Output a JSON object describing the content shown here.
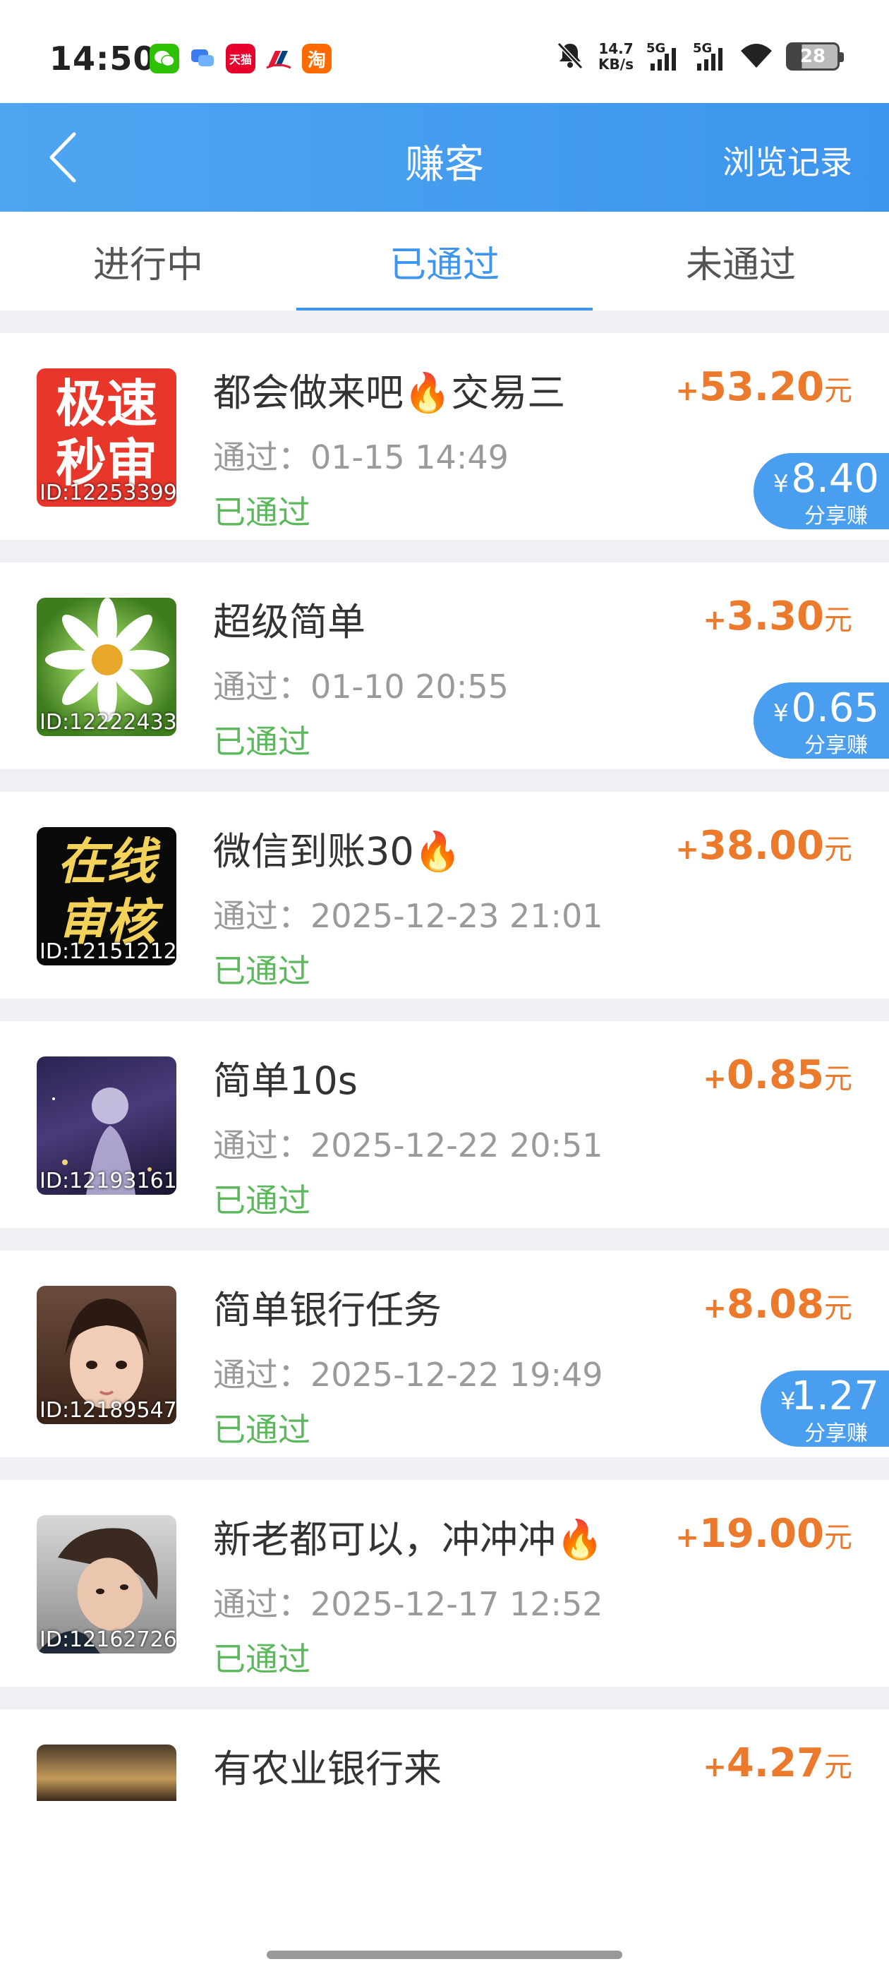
{
  "status_bar": {
    "time": "14:50",
    "net_speed_value": "14.7",
    "net_speed_unit": "KB/s",
    "signal1": "5G",
    "signal2": "5G",
    "battery": "28",
    "notif_icons": [
      "wechat-icon",
      "message-icon",
      "tmall-icon",
      "unionpay-icon",
      "taobao-icon"
    ],
    "tmall_text": "天猫",
    "taobao_text": "淘"
  },
  "header": {
    "title": "赚客",
    "history_label": "浏览记录"
  },
  "tabs": [
    {
      "label": "进行中",
      "active": false
    },
    {
      "label": "已通过",
      "active": true
    },
    {
      "label": "未通过",
      "active": false
    }
  ],
  "tasks": [
    {
      "title": "都会做来吧🔥交易三",
      "time": "通过：01-15 14:49",
      "status": "已通过",
      "plus": "+",
      "amount": "53.20",
      "unit": "元",
      "id": "ID:12253399",
      "thumb_text": [
        "极速",
        "秒审"
      ],
      "share": {
        "yen": "¥",
        "value": "8.40",
        "label": "分享赚"
      }
    },
    {
      "title": "超级简单",
      "time": "通过：01-10 20:55",
      "status": "已通过",
      "plus": "+",
      "amount": "3.30",
      "unit": "元",
      "id": "ID:12222433",
      "share": {
        "yen": "¥",
        "value": "0.65",
        "label": "分享赚"
      }
    },
    {
      "title": "微信到账30🔥",
      "time": "通过：2025-12-23 21:01",
      "status": "已通过",
      "plus": "+",
      "amount": "38.00",
      "unit": "元",
      "id": "ID:12151212",
      "thumb_text": [
        "在线",
        "审核"
      ]
    },
    {
      "title": "简单10s",
      "time": "通过：2025-12-22 20:51",
      "status": "已通过",
      "plus": "+",
      "amount": "0.85",
      "unit": "元",
      "id": "ID:12193161"
    },
    {
      "title": "简单银行任务",
      "time": "通过：2025-12-22 19:49",
      "status": "已通过",
      "plus": "+",
      "amount": "8.08",
      "unit": "元",
      "id": "ID:12189547",
      "share": {
        "yen": "¥",
        "value": "1.27",
        "label": "分享赚"
      }
    },
    {
      "title": "新老都可以，冲冲冲🔥",
      "time": "通过：2025-12-17 12:52",
      "status": "已通过",
      "plus": "+",
      "amount": "19.00",
      "unit": "元",
      "id": "ID:12162726"
    },
    {
      "title": "有农业银行来",
      "plus": "+",
      "amount": "4.27",
      "unit": "元"
    }
  ],
  "colors": {
    "header_bg": "#3d95ee",
    "amount": "#ec7a2d",
    "status_passed": "#5cb85c",
    "share_badge": "#4a9eef"
  }
}
